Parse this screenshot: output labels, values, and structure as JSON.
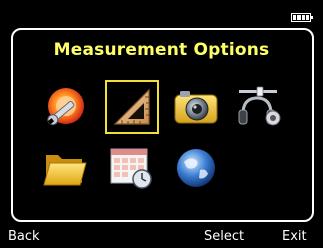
{
  "header": {
    "title": "Measurement Options"
  },
  "status": {
    "battery_level": 1.0
  },
  "menu": {
    "selected_index": 1,
    "items": [
      {
        "icon": "wrench-settings-icon"
      },
      {
        "icon": "set-square-measure-icon"
      },
      {
        "icon": "camera-icon"
      },
      {
        "icon": "headphones-audio-icon"
      },
      {
        "icon": "folder-icon"
      },
      {
        "icon": "calendar-clock-icon"
      },
      {
        "icon": "globe-icon"
      }
    ]
  },
  "softkeys": {
    "left": "Back",
    "center": "Select",
    "right": "Exit"
  },
  "colors": {
    "title": "#ffff66",
    "selection": "#f2df3a",
    "background": "#000000"
  }
}
